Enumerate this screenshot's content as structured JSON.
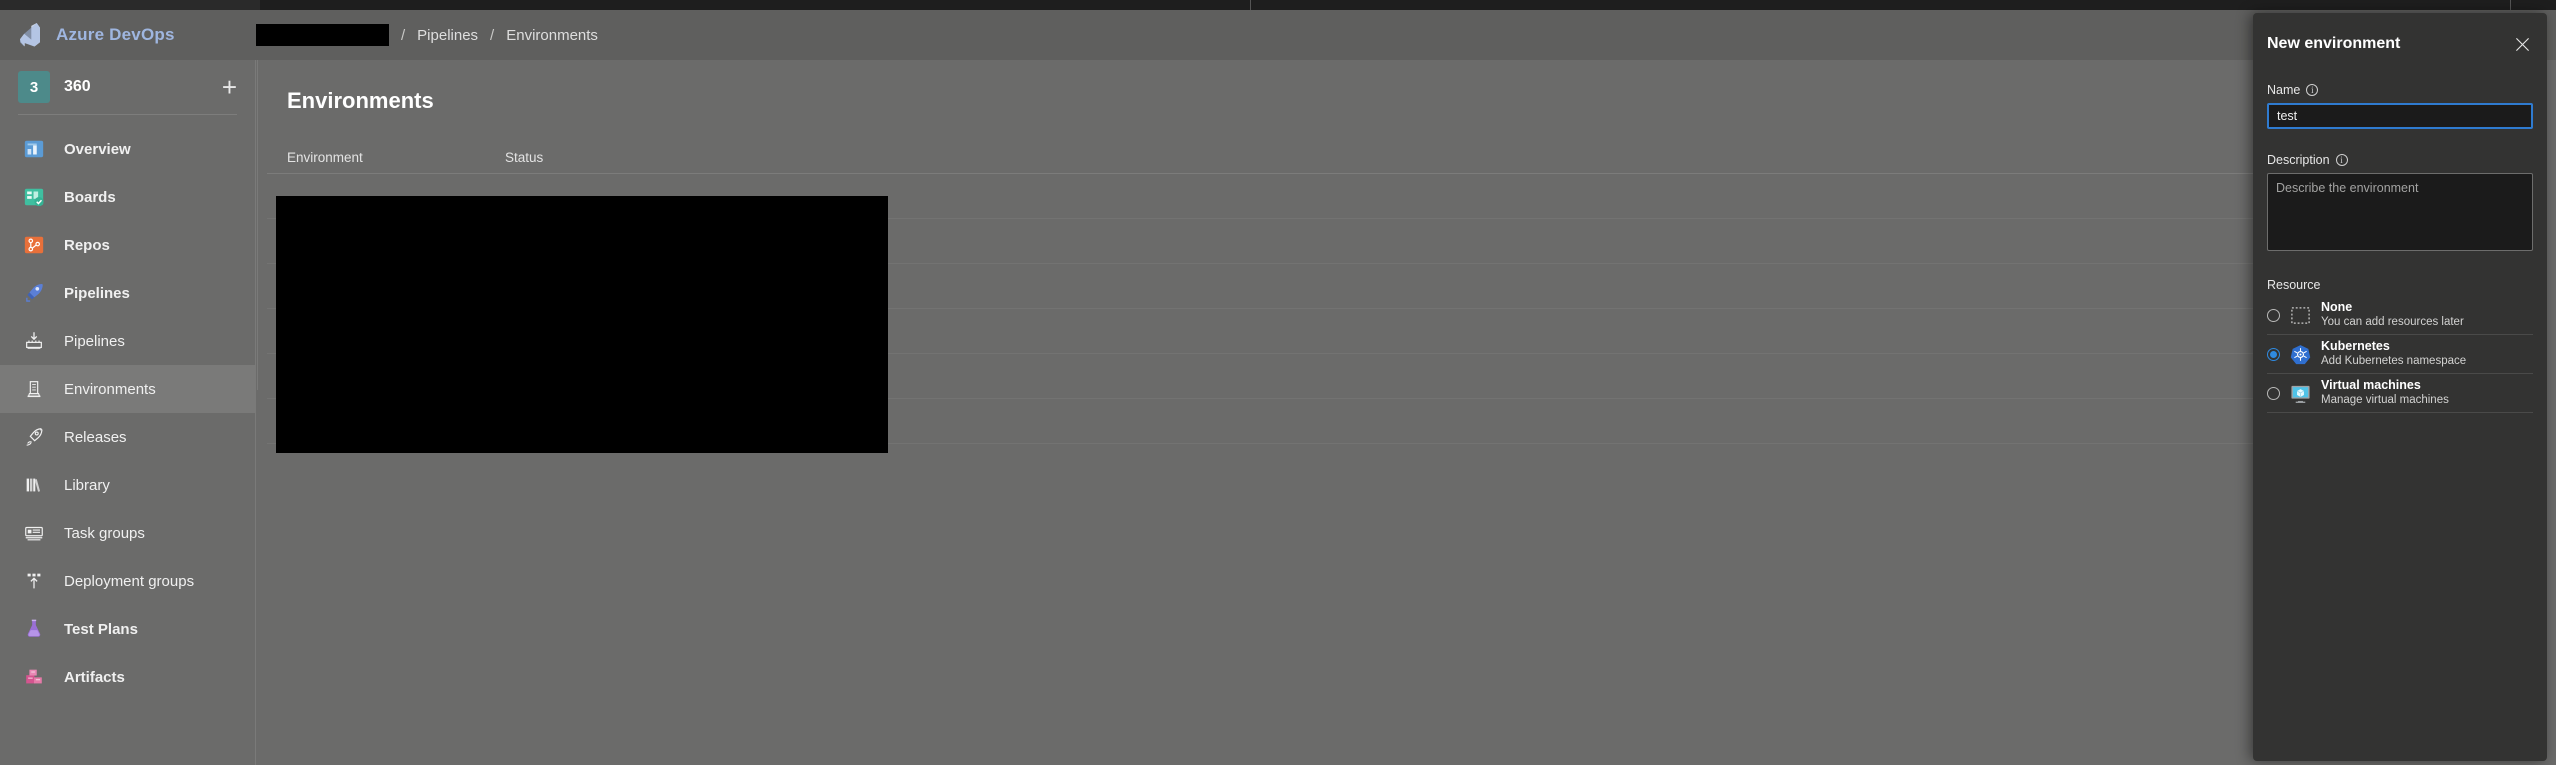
{
  "header": {
    "brand": "Azure DevOps",
    "breadcrumb": {
      "redacted": "",
      "separator": "/",
      "items": [
        "Pipelines",
        "Environments"
      ]
    }
  },
  "sidebar": {
    "project": {
      "initial": "3",
      "name": "360",
      "add_label": "+"
    },
    "items": [
      {
        "label": "Overview",
        "icon": "overview-icon",
        "level": 1,
        "active": false
      },
      {
        "label": "Boards",
        "icon": "boards-icon",
        "level": 1,
        "active": false
      },
      {
        "label": "Repos",
        "icon": "repos-icon",
        "level": 1,
        "active": false
      },
      {
        "label": "Pipelines",
        "icon": "pipelines-hub-icon",
        "level": 1,
        "active": false
      },
      {
        "label": "Pipelines",
        "icon": "pipelines-icon",
        "level": 2,
        "active": false
      },
      {
        "label": "Environments",
        "icon": "environments-icon",
        "level": 2,
        "active": true
      },
      {
        "label": "Releases",
        "icon": "releases-icon",
        "level": 2,
        "active": false
      },
      {
        "label": "Library",
        "icon": "library-icon",
        "level": 2,
        "active": false
      },
      {
        "label": "Task groups",
        "icon": "task-groups-icon",
        "level": 2,
        "active": false
      },
      {
        "label": "Deployment groups",
        "icon": "deployment-groups-icon",
        "level": 2,
        "active": false
      },
      {
        "label": "Test Plans",
        "icon": "test-plans-icon",
        "level": 1,
        "active": false
      },
      {
        "label": "Artifacts",
        "icon": "artifacts-icon",
        "level": 1,
        "active": false
      }
    ]
  },
  "main": {
    "title": "Environments",
    "table": {
      "columns": [
        "Environment",
        "Status"
      ]
    }
  },
  "panel": {
    "title": "New environment",
    "close_label": "✕",
    "name": {
      "label": "Name",
      "value": "test",
      "info": "ⓘ"
    },
    "description": {
      "label": "Description",
      "value": "",
      "placeholder": "Describe the environment",
      "info": "ⓘ"
    },
    "resource": {
      "label": "Resource",
      "options": [
        {
          "title": "None",
          "subtitle": "You can add resources later",
          "icon": "none-dotted-square-icon",
          "selected": false
        },
        {
          "title": "Kubernetes",
          "subtitle": "Add Kubernetes namespace",
          "icon": "kubernetes-icon",
          "selected": true
        },
        {
          "title": "Virtual machines",
          "subtitle": "Manage virtual machines",
          "icon": "virtual-machine-icon",
          "selected": false
        }
      ]
    }
  },
  "colors": {
    "accent_blue": "#2f8ae0",
    "brand_text": "#9fb6e0",
    "panel_bg": "#333332",
    "page_bg": "#6b6b6a",
    "avatar_green": "#3f8f5f"
  }
}
